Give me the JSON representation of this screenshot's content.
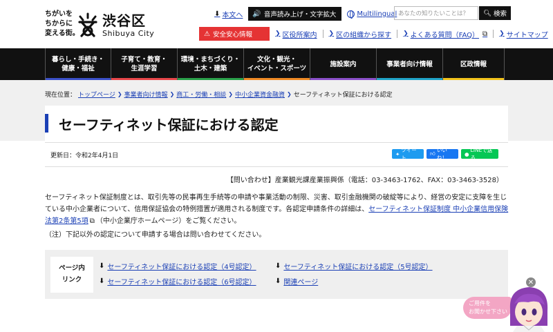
{
  "header": {
    "tagline_line1": "ちがいを",
    "tagline_line2": "ちからに",
    "tagline_line3": "変える街。",
    "logo_name": "渋谷区",
    "logo_roman": "Shibuya City",
    "skip_link": "本文へ",
    "voice_button": "音声読み上げ・文字拡大",
    "multilingual": "Multilingual",
    "search_placeholder": "あなたの知りたいことは？",
    "search_button": "検索",
    "safety_button": "安全安心情報",
    "row2_links": [
      "区役所案内",
      "区の組織から探す",
      "よくある質問（FAQ）",
      "サイトマップ"
    ]
  },
  "nav": [
    {
      "label": "暮らし・手続き・\n健康・福祉",
      "color": "#3b50c7"
    },
    {
      "label": "子育て・教育・\n生涯学習",
      "color": "#e8474a"
    },
    {
      "label": "環境・まちづくり・\n土木・建築",
      "color": "#2aa04a"
    },
    {
      "label": "文化・観光・\nイベント・スポーツ",
      "color": "#f08a24"
    },
    {
      "label": "施設案内",
      "color": "#8a4fc9"
    },
    {
      "label": "事業者向け情報",
      "color": "#20a4c8"
    },
    {
      "label": "区政情報",
      "color": "#f2c21b"
    }
  ],
  "breadcrumb": {
    "prefix": "現在位置：",
    "items": [
      "トップページ",
      "事業者向け情報",
      "商工・労働・相談",
      "中小企業資金融資"
    ],
    "current": "セーフティネット保証における認定"
  },
  "page": {
    "title": "セーフティネット保証における認定",
    "updated": "更新日：令和2年4月1日",
    "share_tweet": "ツイート",
    "share_like": "いいね！",
    "share_line": "LINEで送る",
    "inquiry": "【問い合わせ】産業観光課産業振興係（電話：03-3463-1762、FAX：03-3463-3528）",
    "body_part1": "セーフティネット保証制度とは、取引先等の民事再生手続等の申請や事業活動の制限、災害、取引金融機関の破綻等により、経営の安定に支障を生じている中小企業者について、信用保証協会の特例措置が適用される制度です。各認定申請条件の詳細は、",
    "body_link": "セーフティネット保証制度 中小企業信用保険法第2条第5項",
    "body_part2": "（中小企業庁ホームページ）をご覧ください。",
    "note": "（注）下記以外の認定について申請する場合は問い合わせてください。"
  },
  "anchors": {
    "label_line1": "ページ内",
    "label_line2": "リンク",
    "links": [
      "セーフティネット保証における認定（4号認定）",
      "セーフティネット保証における認定（5号認定）",
      "セーフティネット保証における認定（6号認定）",
      "関連ページ"
    ]
  },
  "chat": {
    "line1": "ご用件を",
    "line2": "お聞かせ下さい"
  }
}
